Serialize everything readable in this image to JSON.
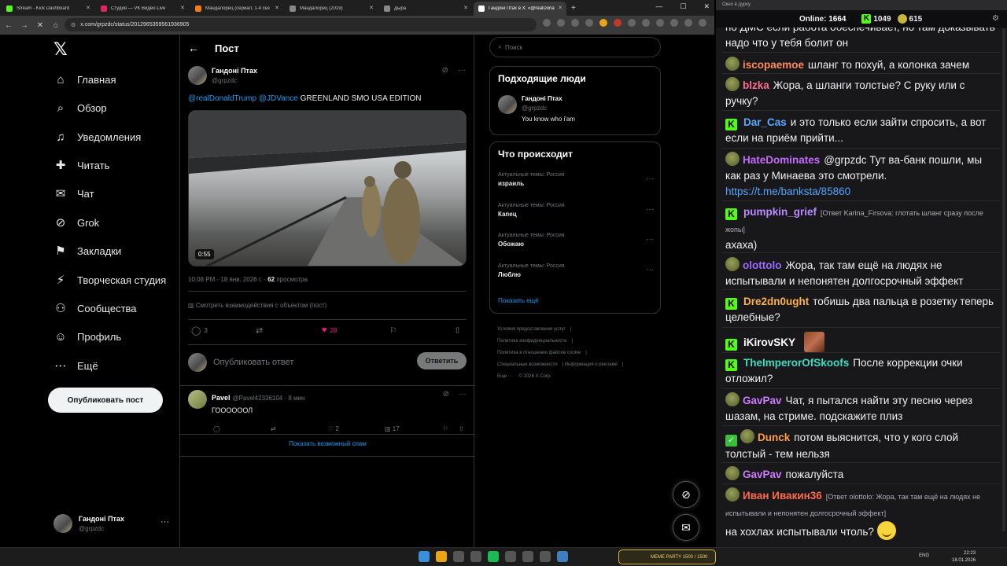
{
  "browser": {
    "tabs": [
      {
        "label": "Stream - Kick Dashboard",
        "color": "#53fc18"
      },
      {
        "label": "Студия — VK Видео Live",
        "color": "#e0245e"
      },
      {
        "label": "Мандалорец (сериал, 1-4 сез",
        "color": "#f27a1a"
      },
      {
        "label": "Мандалорец (2019)",
        "color": "#888888"
      },
      {
        "label": "Дыра",
        "color": "#888888"
      },
      {
        "label": "Гандоні Птах в X: «@realDona",
        "color": "#ffffff",
        "active": true
      }
    ],
    "url": "x.com/grpzdc/status/2012965359561936905"
  },
  "x": {
    "nav": [
      {
        "label": "Главная",
        "icon": "home-icon",
        "glyph": "⌂"
      },
      {
        "label": "Обзор",
        "icon": "search-icon",
        "glyph": "⌕"
      },
      {
        "label": "Уведомления",
        "icon": "bell-icon",
        "glyph": "♫"
      },
      {
        "label": "Читать",
        "icon": "follow-icon",
        "glyph": "✚"
      },
      {
        "label": "Чат",
        "icon": "mail-icon",
        "glyph": "✉"
      },
      {
        "label": "Grok",
        "icon": "grok-icon",
        "glyph": "⊘"
      },
      {
        "label": "Закладки",
        "icon": "bookmark-icon",
        "glyph": "⚑"
      },
      {
        "label": "Творческая студия",
        "icon": "studio-icon",
        "glyph": "⚡"
      },
      {
        "label": "Сообщества",
        "icon": "communities-icon",
        "glyph": "⚇"
      },
      {
        "label": "Профиль",
        "icon": "profile-icon",
        "glyph": "☺"
      },
      {
        "label": "Ещё",
        "icon": "more-icon",
        "glyph": "⋯"
      }
    ],
    "post_button": "Опубликовать пост",
    "me": {
      "name": "Гандоні Птах",
      "handle": "@grpzdc"
    },
    "header_title": "Пост",
    "tweet": {
      "author": "Гандоні Птах",
      "handle": "@grpzdc",
      "mention1": "@realDonaldTrump",
      "mention2": "@JDVance",
      "text": " GREENLAND SMO USA EDITION",
      "duration": "0:55",
      "time": "10:08 PM · 18 янв. 2026 г. · ",
      "views": "62",
      "views_label": " просмотра",
      "activity": "Смотреть взаимодействия с объектом (пост)",
      "replies": "3",
      "likes": "28"
    },
    "reply_placeholder": "Опубликовать ответ",
    "reply_button": "Ответить",
    "reply": {
      "name": "Pavel",
      "meta": "@Pavel42336104 · 8 мин",
      "text": "ГООООООЛ",
      "likes": "2",
      "views": "17"
    },
    "spam_link": "Показать возможный спам",
    "search_placeholder": "Поиск",
    "who_to_follow": {
      "title": "Подходящие люди",
      "name": "Гандоні Птах",
      "handle": "@grpzdc",
      "bio": "You know who i'am"
    },
    "trends": {
      "title": "Что происходит",
      "items": [
        {
          "category": "Актуальные темы: Россия",
          "name": "израиль"
        },
        {
          "category": "Актуальные темы: Россия",
          "name": "Капец"
        },
        {
          "category": "Актуальные темы: Россия",
          "name": "Обожаю"
        },
        {
          "category": "Актуальные темы: Россия",
          "name": "Люблю"
        }
      ],
      "show_more": "Показать ещё"
    },
    "footer": [
      "Условия предоставления услуг",
      "Политика конфиденциальности",
      "Политика в отношении файлов cookie",
      "Специальные возможности",
      "Информация о рекламе",
      "Еще ···",
      "© 2026 X Corp."
    ]
  },
  "chat": {
    "window_title": "Окно в дурку",
    "online_label": "Online:",
    "online": "1664",
    "k_count": "1049",
    "coin_count": "615",
    "messages": [
      {
        "user": "",
        "text": "по ДМС если работа обеспечивает, но там доказывать надо что у тебя болит он",
        "badge": "none"
      },
      {
        "user": "iscopaemoe",
        "color": "#ff8a5c",
        "text": "шланг то похуй, а колонка зачем",
        "badge": "pepe"
      },
      {
        "user": "blzka",
        "color": "#ff6f91",
        "text": "Жора, а шланги толстые? С руку или с ручку?",
        "badge": "pepe"
      },
      {
        "user": "Dar_Cas",
        "color": "#5aa9ff",
        "text": "и это только если зайти спросить, а вот если на приём прийти...",
        "badge": "kick"
      },
      {
        "user": "HateDominates",
        "color": "#c66bff",
        "text": "@grpzdc Тут ва-банк пошли, мы как раз у Минаева это смотрели. ",
        "link": "https://t.me/banksta/85860",
        "badge": "pepe"
      },
      {
        "user": "pumpkin_grief",
        "color": "#b98cff",
        "reply": "[Ответ Karina_Firsova: глотать шланг сразу после жопы]",
        "text": "ахаха)",
        "badge": "kick"
      },
      {
        "user": "olottolo",
        "color": "#9b6bff",
        "text": "Жора, так там ещё на людях не испытывали и непонятен долгосрочный эффект",
        "badge": "pepe"
      },
      {
        "user": "Dre2dn0ught",
        "color": "#ffb14a",
        "text": "тобишь два пальца в розетку теперь целебные?",
        "badge": "kick"
      },
      {
        "user": "iKirovSKY",
        "color": "#ffffff",
        "text": "",
        "badge": "kick"
      },
      {
        "user": "TheImperorOfSkoofs",
        "color": "#3fdcc0",
        "text": "После коррекции очки отложил?",
        "badge": "kick"
      },
      {
        "user": "GavPav",
        "color": "#cf7bff",
        "text": "Чат, я пытался найти эту песню через шазам, на стриме. подскажите плиз",
        "badge": "pepe"
      },
      {
        "user": "Dunck",
        "color": "#ff9f40",
        "text": "потом выяснится, что у кого слой толстый - тем нельзя",
        "badge": "check"
      },
      {
        "user": "GavPav",
        "color": "#cf7bff",
        "text": "пожалуйста",
        "badge": "pepe"
      },
      {
        "user": "Иван Ивакин36",
        "color": "#ff6b4a",
        "reply": "[Ответ olottolo: Жора, так там ещё на людях не испытывали и непонятен долгосрочный эффект]",
        "text": "на хохлах испытывали чтоль?",
        "badge": "pepe"
      }
    ]
  },
  "taskbar": {
    "banner": "MEME PARTY  1500 / 1500",
    "lang": "ENG",
    "time": "22:23",
    "date": "18.01.2026"
  }
}
